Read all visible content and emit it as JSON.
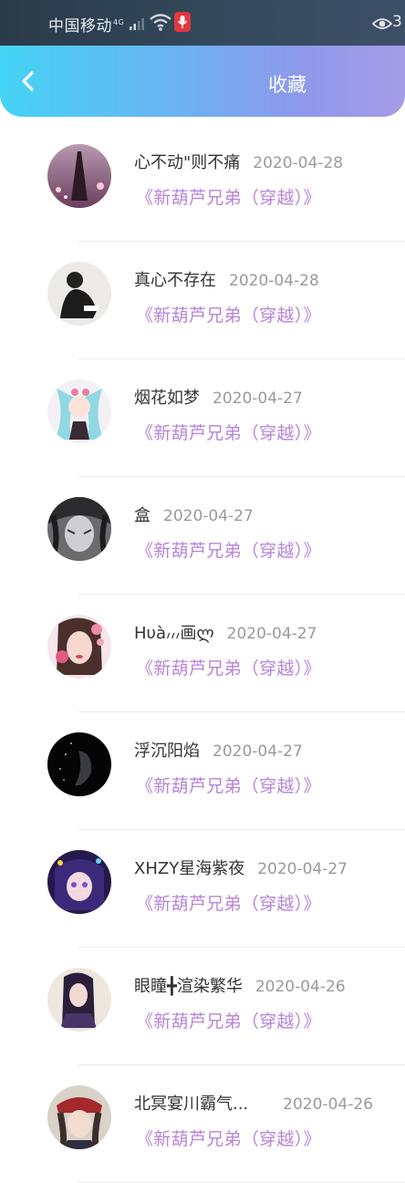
{
  "status_bar": {
    "carrier": "中国移动",
    "network": "4G",
    "eye_count": "3",
    "icons": [
      "signal-icon",
      "wifi-icon",
      "mic-icon",
      "eye-icon"
    ]
  },
  "header": {
    "title": "收藏",
    "back_icon": "chevron-left-icon"
  },
  "favorites": [
    {
      "name": "心不动\"则不痛",
      "date": "2020-04-28",
      "book": "《新葫芦兄弟（穿越）》"
    },
    {
      "name": "真心不存在",
      "date": "2020-04-28",
      "book": "《新葫芦兄弟（穿越）》"
    },
    {
      "name": "烟花如梦",
      "date": "2020-04-27",
      "book": "《新葫芦兄弟（穿越）》"
    },
    {
      "name": "盒",
      "date": "2020-04-27",
      "book": "《新葫芦兄弟（穿越）》"
    },
    {
      "name": "Hυà៸៸៸画ლ",
      "date": "2020-04-27",
      "book": "《新葫芦兄弟（穿越）》"
    },
    {
      "name": "浮沉阳焰",
      "date": "2020-04-27",
      "book": "《新葫芦兄弟（穿越）》"
    },
    {
      "name": "XHZY星海紫夜",
      "date": "2020-04-27",
      "book": "《新葫芦兄弟（穿越）》"
    },
    {
      "name": "眼瞳╋渲染繁华",
      "date": "2020-04-26",
      "book": "《新葫芦兄弟（穿越）》"
    },
    {
      "name": "北冥宴川霸气...",
      "date": "2020-04-26",
      "book": "《新葫芦兄弟（穿越）》"
    }
  ],
  "colors": {
    "header_gradient_start": "#45d4f5",
    "header_gradient_end": "#a59ce7",
    "book_title": "#b685d9",
    "date": "#9a9a9a"
  }
}
